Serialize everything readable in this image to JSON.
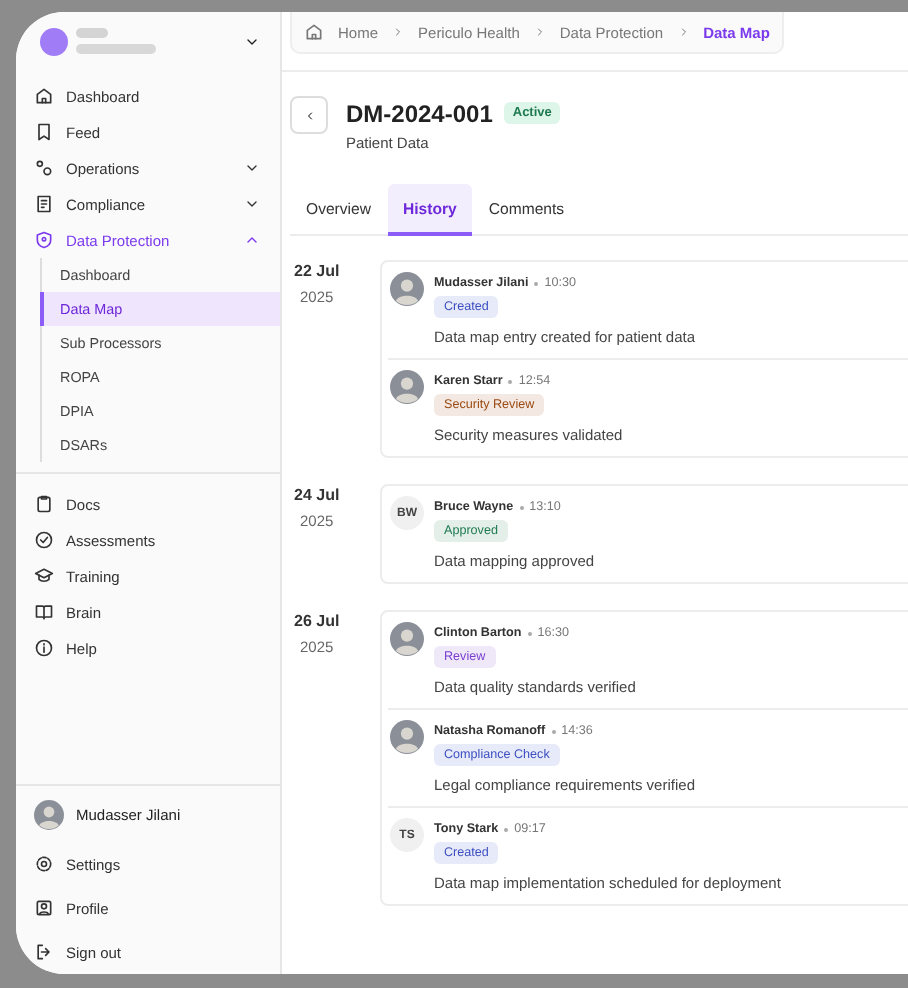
{
  "sidebar": {
    "nav": [
      {
        "label": "Dashboard",
        "selected": false
      },
      {
        "label": "Feed",
        "selected": false
      },
      {
        "label": "Operations",
        "selected": false,
        "expanded": false
      },
      {
        "label": "Compliance",
        "selected": false,
        "expanded": false
      },
      {
        "label": "Data Protection",
        "selected": true,
        "expanded": true,
        "children": [
          {
            "label": "Dashboard",
            "selected": false
          },
          {
            "label": "Data Map",
            "selected": true
          },
          {
            "label": "Sub Processors",
            "selected": false
          },
          {
            "label": "ROPA",
            "selected": false
          },
          {
            "label": "DPIA",
            "selected": false
          },
          {
            "label": "DSARs",
            "selected": false
          }
        ]
      }
    ],
    "tools": [
      {
        "label": "Docs"
      },
      {
        "label": "Assessments"
      },
      {
        "label": "Training"
      },
      {
        "label": "Brain"
      },
      {
        "label": "Help"
      }
    ],
    "user": {
      "name": "Mudasser Jilani"
    },
    "footer": [
      {
        "label": "Settings"
      },
      {
        "label": "Profile"
      },
      {
        "label": "Sign out"
      }
    ]
  },
  "breadcrumb": [
    {
      "label": "Home",
      "selected": false
    },
    {
      "label": "Periculo Health",
      "selected": false
    },
    {
      "label": "Data Protection",
      "selected": false
    },
    {
      "label": "Data Map",
      "selected": true
    }
  ],
  "record": {
    "title": "DM-2024-001",
    "status": "Active",
    "subtitle": "Patient Data"
  },
  "tabs": [
    {
      "label": "Overview",
      "selected": false
    },
    {
      "label": "History",
      "selected": true
    },
    {
      "label": "Comments",
      "selected": false
    }
  ],
  "history": [
    {
      "date": "22 Jul",
      "year": "2025",
      "entries": [
        {
          "avatar": {
            "kind": "photo"
          },
          "author": "Mudasser Jilani",
          "time": "10:30",
          "badge": {
            "label": "Created",
            "color": "#3d4fc2"
          },
          "text": "Data map entry created for patient data"
        },
        {
          "avatar": {
            "kind": "photo"
          },
          "author": "Karen Starr",
          "time": "12:54",
          "badge": {
            "label": "Security Review",
            "color": "#9a4a12"
          },
          "text": "Security measures validated"
        }
      ]
    },
    {
      "date": "24 Jul",
      "year": "2025",
      "entries": [
        {
          "avatar": {
            "kind": "initials",
            "initials": "BW"
          },
          "author": "Bruce Wayne",
          "time": "13:10",
          "badge": {
            "label": "Approved",
            "color": "#1f7a4f"
          },
          "text": "Data mapping approved"
        }
      ]
    },
    {
      "date": "26 Jul",
      "year": "2025",
      "entries": [
        {
          "avatar": {
            "kind": "photo"
          },
          "author": "Clinton Barton",
          "time": "16:30",
          "badge": {
            "label": "Review",
            "color": "#7a3fd0"
          },
          "text": "Data quality standards verified"
        },
        {
          "avatar": {
            "kind": "photo"
          },
          "author": "Natasha Romanoff",
          "time": "14:36",
          "badge": {
            "label": "Compliance Check",
            "color": "#3d4fc2"
          },
          "text": "Legal compliance requirements verified"
        },
        {
          "avatar": {
            "kind": "initials",
            "initials": "TS"
          },
          "author": "Tony Stark",
          "time": "09:17",
          "badge": {
            "label": "Created",
            "color": "#3d4fc2"
          },
          "text": "Data map implementation scheduled for deployment"
        }
      ]
    }
  ]
}
